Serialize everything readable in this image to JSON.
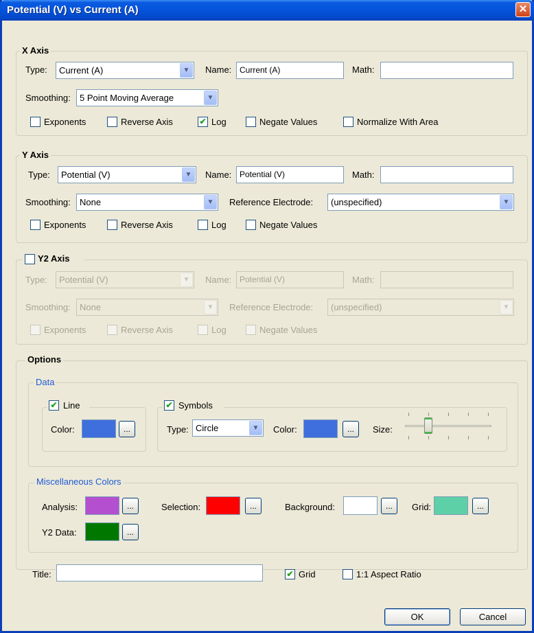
{
  "window": {
    "title": "Potential (V) vs Current (A)",
    "close": "✕"
  },
  "x_axis": {
    "heading": "X Axis",
    "type_label": "Type:",
    "type_value": "Current (A)",
    "name_label": "Name:",
    "name_value": "Current (A)",
    "math_label": "Math:",
    "math_value": "",
    "smoothing_label": "Smoothing:",
    "smoothing_value": "5 Point Moving Average",
    "exponents": "Exponents",
    "reverse_axis": "Reverse Axis",
    "log": "Log",
    "negate_values": "Negate Values",
    "normalize_with_area": "Normalize With Area",
    "checks": {
      "exponents": false,
      "reverse_axis": false,
      "log": true,
      "negate_values": false,
      "normalize_with_area": false
    }
  },
  "y_axis": {
    "heading": "Y Axis",
    "type_label": "Type:",
    "type_value": "Potential (V)",
    "name_label": "Name:",
    "name_value": "Potential (V)",
    "math_label": "Math:",
    "math_value": "",
    "smoothing_label": "Smoothing:",
    "smoothing_value": "None",
    "ref_label": "Reference Electrode:",
    "ref_value": "(unspecified)",
    "exponents": "Exponents",
    "reverse_axis": "Reverse Axis",
    "log": "Log",
    "negate_values": "Negate Values",
    "checks": {
      "exponents": false,
      "reverse_axis": false,
      "log": false,
      "negate_values": false
    }
  },
  "y2_axis": {
    "heading": "Y2 Axis",
    "enabled": false,
    "type_label": "Type:",
    "type_value": "Potential (V)",
    "name_label": "Name:",
    "name_value": "Potential (V)",
    "math_label": "Math:",
    "math_value": "",
    "smoothing_label": "Smoothing:",
    "smoothing_value": "None",
    "ref_label": "Reference Electrode:",
    "ref_value": "(unspecified)",
    "exponents": "Exponents",
    "reverse_axis": "Reverse Axis",
    "log": "Log",
    "negate_values": "Negate Values"
  },
  "options": {
    "heading": "Options",
    "data": {
      "heading": "Data",
      "line_label": "Line",
      "line_checked": true,
      "line_color_label": "Color:",
      "line_color": "#3f6fdc",
      "symbols_label": "Symbols",
      "symbols_checked": true,
      "symbol_type_label": "Type:",
      "symbol_type_value": "Circle",
      "symbol_color_label": "Color:",
      "symbol_color": "#3f6fdc",
      "size_label": "Size:",
      "size_level": 0.25
    },
    "misc": {
      "heading": "Miscellaneous  Colors",
      "analysis_label": "Analysis:",
      "analysis_color": "#b44fd0",
      "selection_label": "Selection:",
      "selection_color": "#ff0000",
      "background_label": "Background:",
      "background_color": "#ffffff",
      "grid_label": "Grid:",
      "grid_color": "#5ed0a8",
      "y2data_label": "Y2 Data:",
      "y2data_color": "#007800"
    },
    "dots": "...",
    "title_label": "Title:",
    "title_value": "",
    "grid_label": "Grid",
    "grid_checked": true,
    "aspect_label": "1:1 Aspect Ratio",
    "aspect_checked": false
  },
  "buttons": {
    "ok": "OK",
    "cancel": "Cancel"
  },
  "glyphs": {
    "check": "✔",
    "dropdown": "▼"
  }
}
